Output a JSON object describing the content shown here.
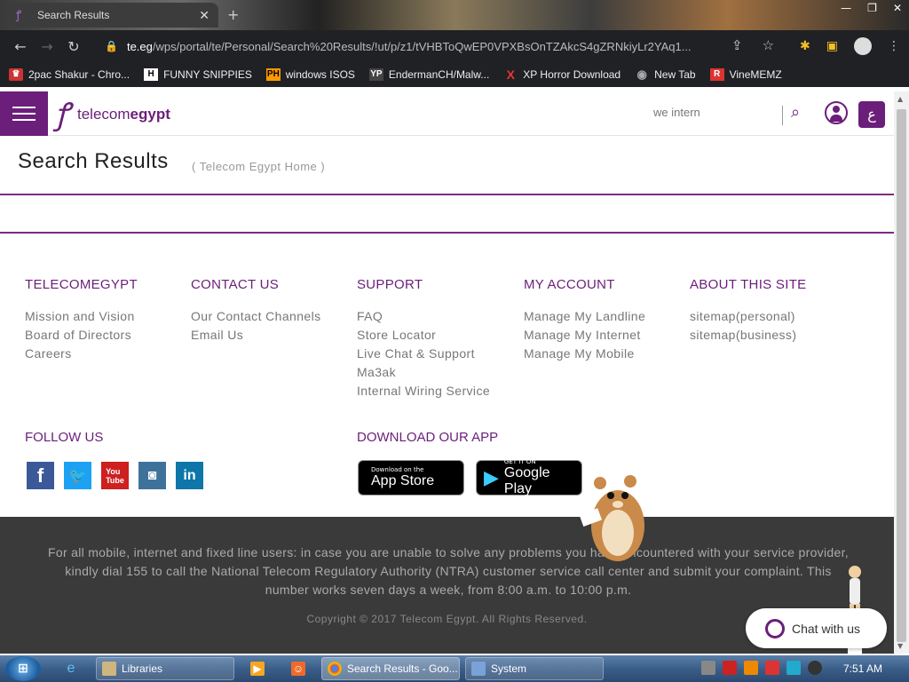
{
  "browser": {
    "tab_title": "Search Results",
    "url_host": "te.eg",
    "url_path": "/wps/portal/te/Personal/Search%20Results/!ut/p/z1/tVHBToQwEP0VPXBsOnTZAkcS4gZRNkiyLr2YAq1...",
    "bookmarks": [
      {
        "label": "2pac Shakur - Chro...",
        "icon": "2pac-icon"
      },
      {
        "label": "FUNNY SNIPPIES",
        "icon": "H"
      },
      {
        "label": "windows ISOS",
        "icon": "PH"
      },
      {
        "label": "EndermanCH/Malw...",
        "icon": "YP"
      },
      {
        "label": "XP Horror Download",
        "icon": "X"
      },
      {
        "label": "New Tab",
        "icon": "globe-icon"
      },
      {
        "label": "VineMEMZ",
        "icon": "R"
      }
    ]
  },
  "header": {
    "logo_a": "telecom",
    "logo_b": "egypt",
    "search_value": "we intern",
    "lang_label": "ع"
  },
  "page": {
    "title": "Search Results",
    "crumb": "( Telecom Egypt Home )"
  },
  "footer": {
    "columns": [
      {
        "heading": "TELECOMEGYPT",
        "links": [
          "Mission and Vision",
          "Board of Directors",
          "Careers"
        ]
      },
      {
        "heading": "CONTACT US",
        "links": [
          "Our Contact Channels",
          "Email Us"
        ]
      },
      {
        "heading": "SUPPORT",
        "links": [
          "FAQ",
          "Store Locator",
          "Live Chat & Support",
          "Ma3ak",
          "Internal Wiring Service"
        ]
      },
      {
        "heading": "MY ACCOUNT",
        "links": [
          "Manage My Landline",
          "Manage My Internet",
          "Manage My Mobile"
        ]
      },
      {
        "heading": "ABOUT THIS SITE",
        "links": [
          "sitemap(personal)",
          "sitemap(business)"
        ]
      }
    ],
    "follow_title": "FOLLOW US",
    "download_title": "DOWNLOAD OUR APP",
    "appstore_small": "Download on the",
    "appstore_big": "App Store",
    "googleplay_small": "GET IT ON",
    "googleplay_big": "Google Play",
    "notice": "For all mobile, internet and fixed line users: in case you are unable to solve any problems you have encountered with your service provider, kindly dial 155 to call the National Telecom Regulatory Authority (NTRA) customer service call center and submit your complaint. This number works seven days a week, from 8:00 a.m. to 10:00 p.m.",
    "copyright": "Copyright © 2017 Telecom Egypt. All Rights Reserved.",
    "chat_label": "Chat with us"
  },
  "taskbar": {
    "items": [
      {
        "label": "Libraries"
      },
      {
        "label": "Search Results - Goo..."
      },
      {
        "label": "System"
      }
    ],
    "clock": "7:51 AM"
  },
  "colors": {
    "brand": "#6b1e7a",
    "dark_footer": "#3a3a3a"
  }
}
